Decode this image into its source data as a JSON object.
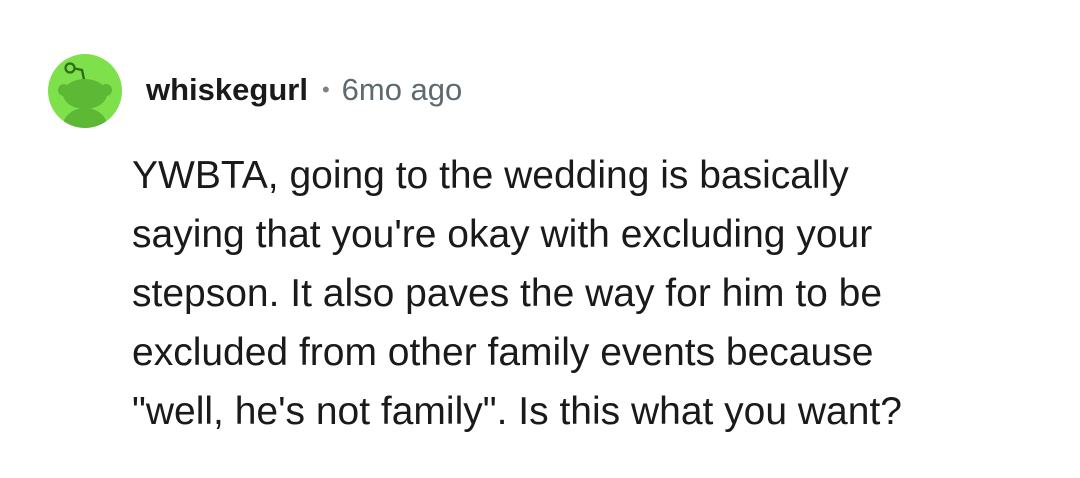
{
  "comment": {
    "avatar": {
      "icon": "snoo-avatar-icon",
      "background": "#7ee04a"
    },
    "username": "whiskegurl",
    "separator": "•",
    "age": "6mo ago",
    "lines": [
      "YWBTA, going to the wedding is basically",
      "saying that you're okay with excluding your",
      "stepson. It also paves the way for him to be",
      "excluded from other family events because",
      "\"well, he's not family\". Is this what you want?"
    ]
  }
}
